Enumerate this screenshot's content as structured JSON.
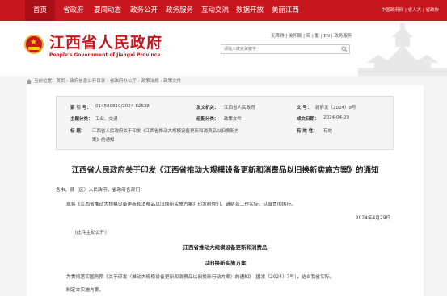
{
  "nav": {
    "items": [
      "首页",
      "省政府",
      "要闻动态",
      "政务公开",
      "政务服务",
      "互动交流",
      "数据开放",
      "美丽江西"
    ],
    "right": "中国政府网 | 省人大 | 省政协"
  },
  "header": {
    "title": "江西省人民政府",
    "subtitle": "People's Government of Jiangxi Province",
    "links": "无障碍 | 关怀版 | 简 | 繁 | EN | 政务服务",
    "search_placeholder": "请输入搜索关键字"
  },
  "breadcrumb": "当前位置：首页 › 政府信息公开目录 › 省政府办公厅 › 政策法规 › 政策文件",
  "meta": {
    "index_label": "索 引 号：",
    "index_value": "014500810/2024-82538",
    "issuer_label": "发文机关：",
    "issuer_value": "江西省人民政府",
    "docno_label": "文 号：",
    "docno_value": "赣府发〔2024〕9号",
    "topic_label": "主题分类：",
    "topic_value": "工业、交通",
    "type_label": "组配分类：",
    "type_value": "政策文件",
    "date_label": "成文日期：",
    "date_value": "2024-04-29",
    "title_label": "标 题：",
    "title_value_1": "江西省人民政府关于印发《江西省推动大规模设备更新和消费品以旧换新方",
    "title_value_2": "案》的通知",
    "validity_label": "有 效 性：",
    "validity_value": "有效"
  },
  "doc": {
    "title": "江西省人民政府关于印发《江西省推动大规模设备更新和消费品以旧换新实施方案》的通知",
    "salutation": "各市、县（区）人民政府，省政府各部门：",
    "body1": "现将《江西省推动大规模设备更新和消费品以旧换新实施方案》印发给你们，请结合工作实际，认真贯彻执行。",
    "date": "2024年4月29日",
    "public": "（此件主动公开）",
    "sub_title_1": "江西省推动大规模设备更新和消费品",
    "sub_title_2": "以旧换新实施方案",
    "body2": "为贯彻落实国务院《关于印发〈推动大规模设备更新和消费品以旧换新行动方案〉的通知》（国发〔2024〕7号），结合我省实际，",
    "body3": "制定本实施方案。"
  },
  "colors": {
    "brand": "#c8161e"
  }
}
